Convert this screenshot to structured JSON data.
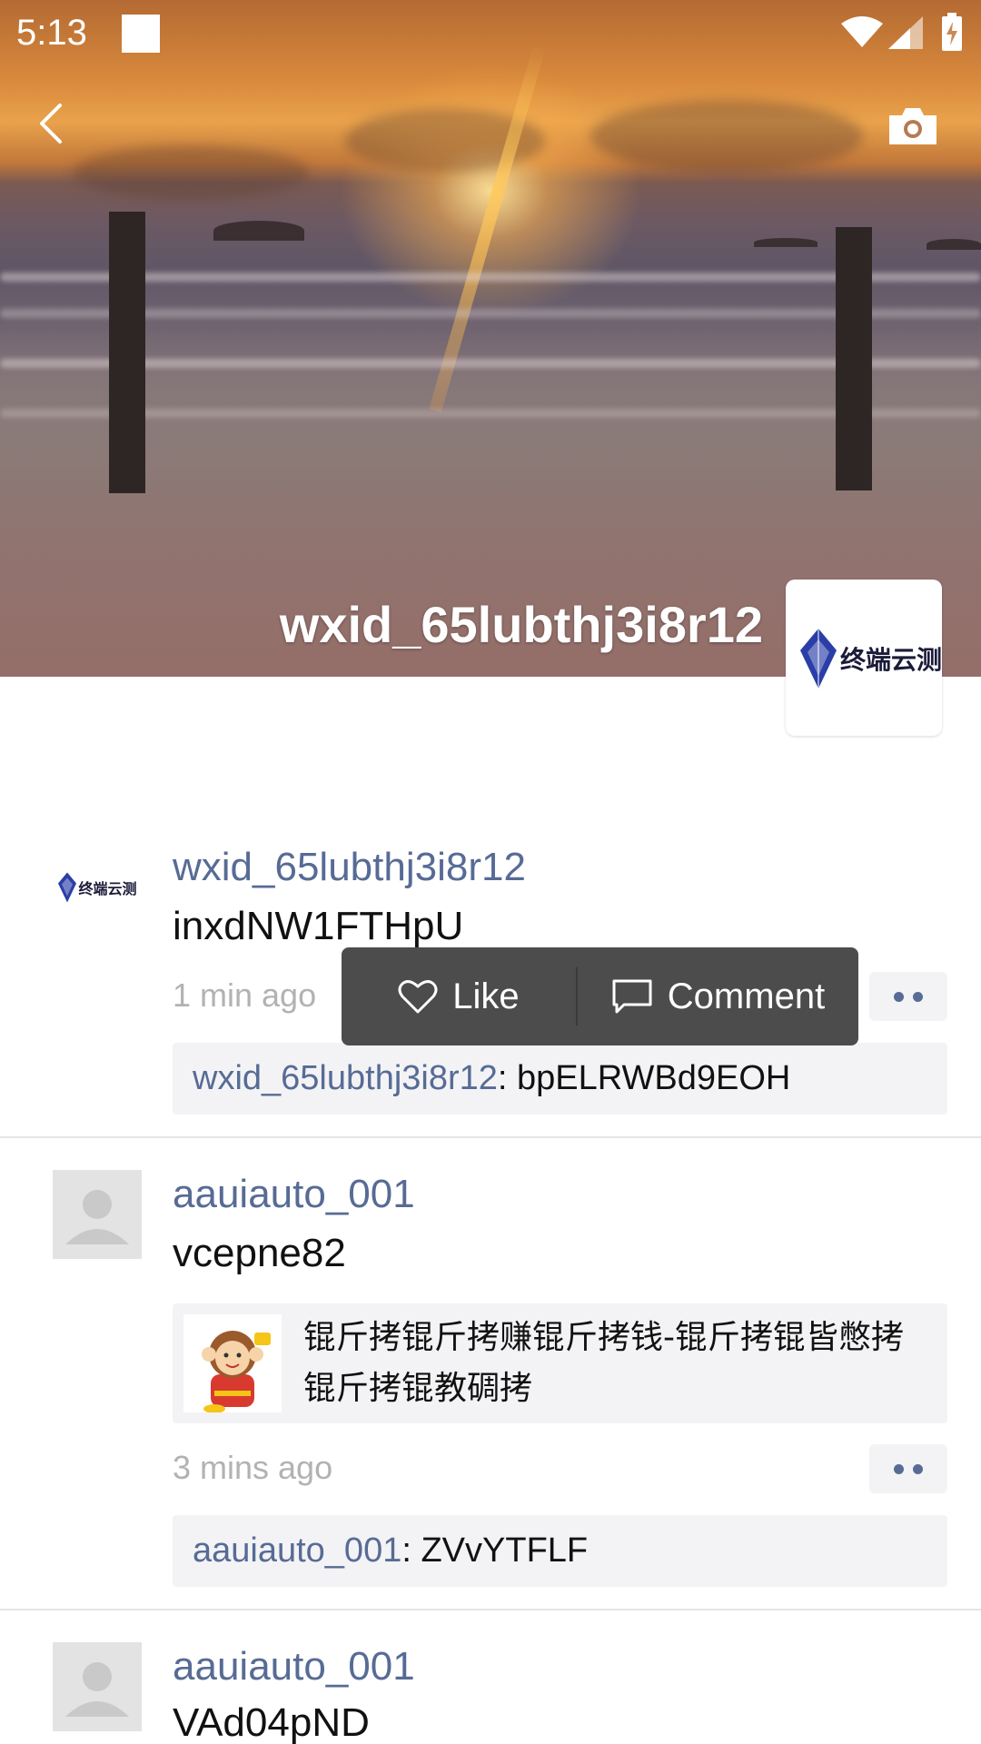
{
  "status_bar": {
    "time": "5:13"
  },
  "cover": {
    "username": "wxid_65lubthj3i8r12",
    "logo_text": "终端云测"
  },
  "posts": [
    {
      "author": "wxid_65lubthj3i8r12",
      "text": "inxdNW1FTHpU",
      "time": "1 min ago",
      "avatar_logo_text": "终端云测",
      "comments": [
        {
          "author": "wxid_65lubthj3i8r12",
          "sep": ": ",
          "text": "bpELRWBd9EOH"
        }
      ]
    },
    {
      "author": "aauiauto_001",
      "text": "vcepne82",
      "link_card": {
        "title": "锟斤拷锟斤拷赚锟斤拷钱-锟斤拷锟皆憋拷锟斤拷锟教碉拷"
      },
      "time": "3 mins ago",
      "comments": [
        {
          "author": "aauiauto_001",
          "sep": ": ",
          "text": "ZVvYTFLF"
        }
      ]
    },
    {
      "author": "aauiauto_001",
      "text": "VAd04pND"
    }
  ],
  "popup": {
    "like_label": "Like",
    "comment_label": "Comment"
  },
  "colors": {
    "link_blue": "#576b95",
    "popup_bg": "#4c4c4c",
    "comment_bg": "#f3f3f5"
  }
}
